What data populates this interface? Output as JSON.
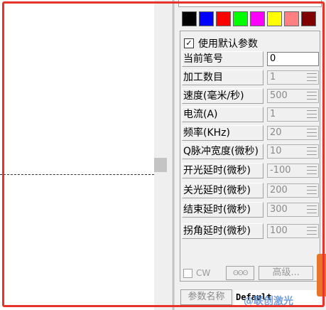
{
  "palette": [
    "#000000",
    "#0000ff",
    "#ff0000",
    "#00ff00",
    "#ff00ff",
    "#ffff00",
    "#ff8080",
    "#800000"
  ],
  "use_default": {
    "checked_mark": "✓",
    "label": "使用默认参数"
  },
  "params": [
    {
      "label": "当前笔号",
      "value": "0",
      "enabled": true,
      "spin": false
    },
    {
      "label": "加工数目",
      "value": "1",
      "enabled": false,
      "spin": true
    },
    {
      "label": "速度(毫米/秒)",
      "value": "500",
      "enabled": false,
      "spin": true
    },
    {
      "label": "电流(A)",
      "value": "1",
      "enabled": false,
      "spin": true
    },
    {
      "label": "频率(KHz)",
      "value": "20",
      "enabled": false,
      "spin": true
    },
    {
      "label": "Q脉冲宽度(微秒)",
      "value": "10",
      "enabled": false,
      "spin": true
    },
    {
      "label": "开光延时(微秒)",
      "value": "-100",
      "enabled": false,
      "spin": true
    },
    {
      "label": "关光延时(微秒)",
      "value": "200",
      "enabled": false,
      "spin": true
    },
    {
      "label": "结束延时(微秒)",
      "value": "300",
      "enabled": false,
      "spin": true
    },
    {
      "label": "拐角延时(微秒)",
      "value": "100",
      "enabled": false,
      "spin": true
    }
  ],
  "bottom": {
    "cw_label": "CW",
    "spring_label": "ʘʘʘ",
    "advanced_label": "高级..."
  },
  "param_name": {
    "button_label": "参数名称",
    "value": "Default"
  },
  "watermark": "@联创激光"
}
